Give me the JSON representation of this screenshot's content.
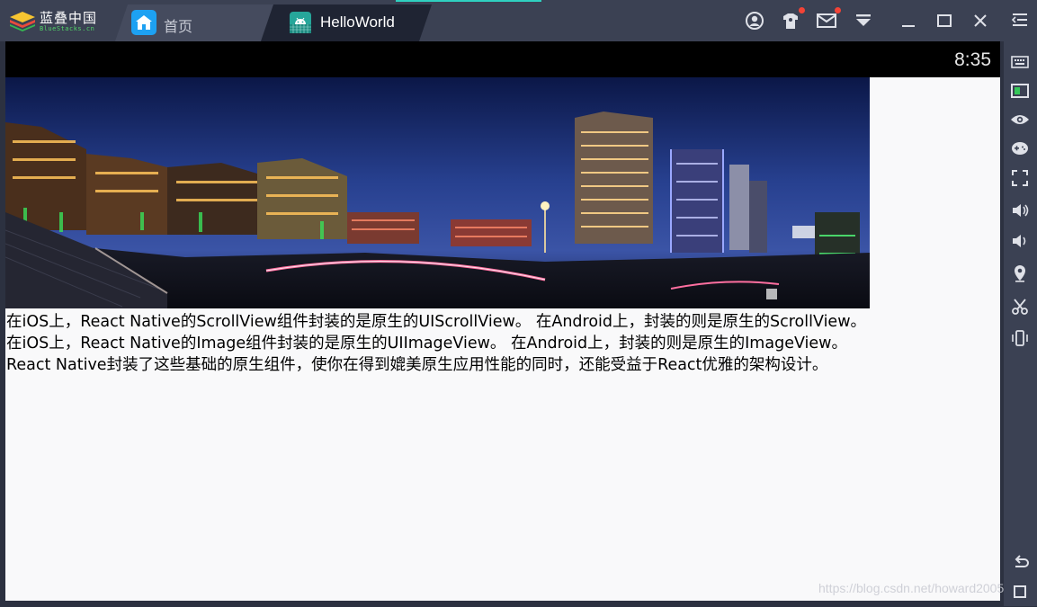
{
  "app": {
    "logo_text": "蓝叠中国",
    "logo_subtext": "BlueStacks.cn"
  },
  "tabs": [
    {
      "label": "首页",
      "icon": "home-icon"
    },
    {
      "label": "HelloWorld",
      "icon": "android-icon"
    }
  ],
  "title_icons": [
    "account-icon",
    "gift-icon",
    "mail-icon",
    "dropdown-icon",
    "minimize-icon",
    "maximize-icon",
    "close-icon"
  ],
  "sidebar_icons": [
    "expand-icon",
    "keyboard-icon",
    "toggle-icon",
    "eye-icon",
    "gamepad-icon",
    "fullscreen-icon",
    "volume-up-icon",
    "volume-down-icon",
    "location-icon",
    "scissors-icon",
    "rotate-icon",
    "back-icon"
  ],
  "status": {
    "time": "8:35"
  },
  "content": {
    "lines": [
      "在iOS上，React Native的ScrollView组件封装的是原生的UIScrollView。 在Android上，封装的则是原生的ScrollView。",
      "在iOS上，React Native的Image组件封装的是原生的UIImageView。 在Android上，封装的则是原生的ImageView。",
      "React Native封装了这些基础的原生组件，使你在得到媲美原生应用性能的同时，还能受益于React优雅的架构设计。"
    ]
  },
  "watermark": "https://blog.csdn.net/howard2005",
  "colors": {
    "accent": "#2fd0c0",
    "titlebar": "#3b4153",
    "notification_dot": "#f44336",
    "screen_bg": "#f9f9fa"
  }
}
